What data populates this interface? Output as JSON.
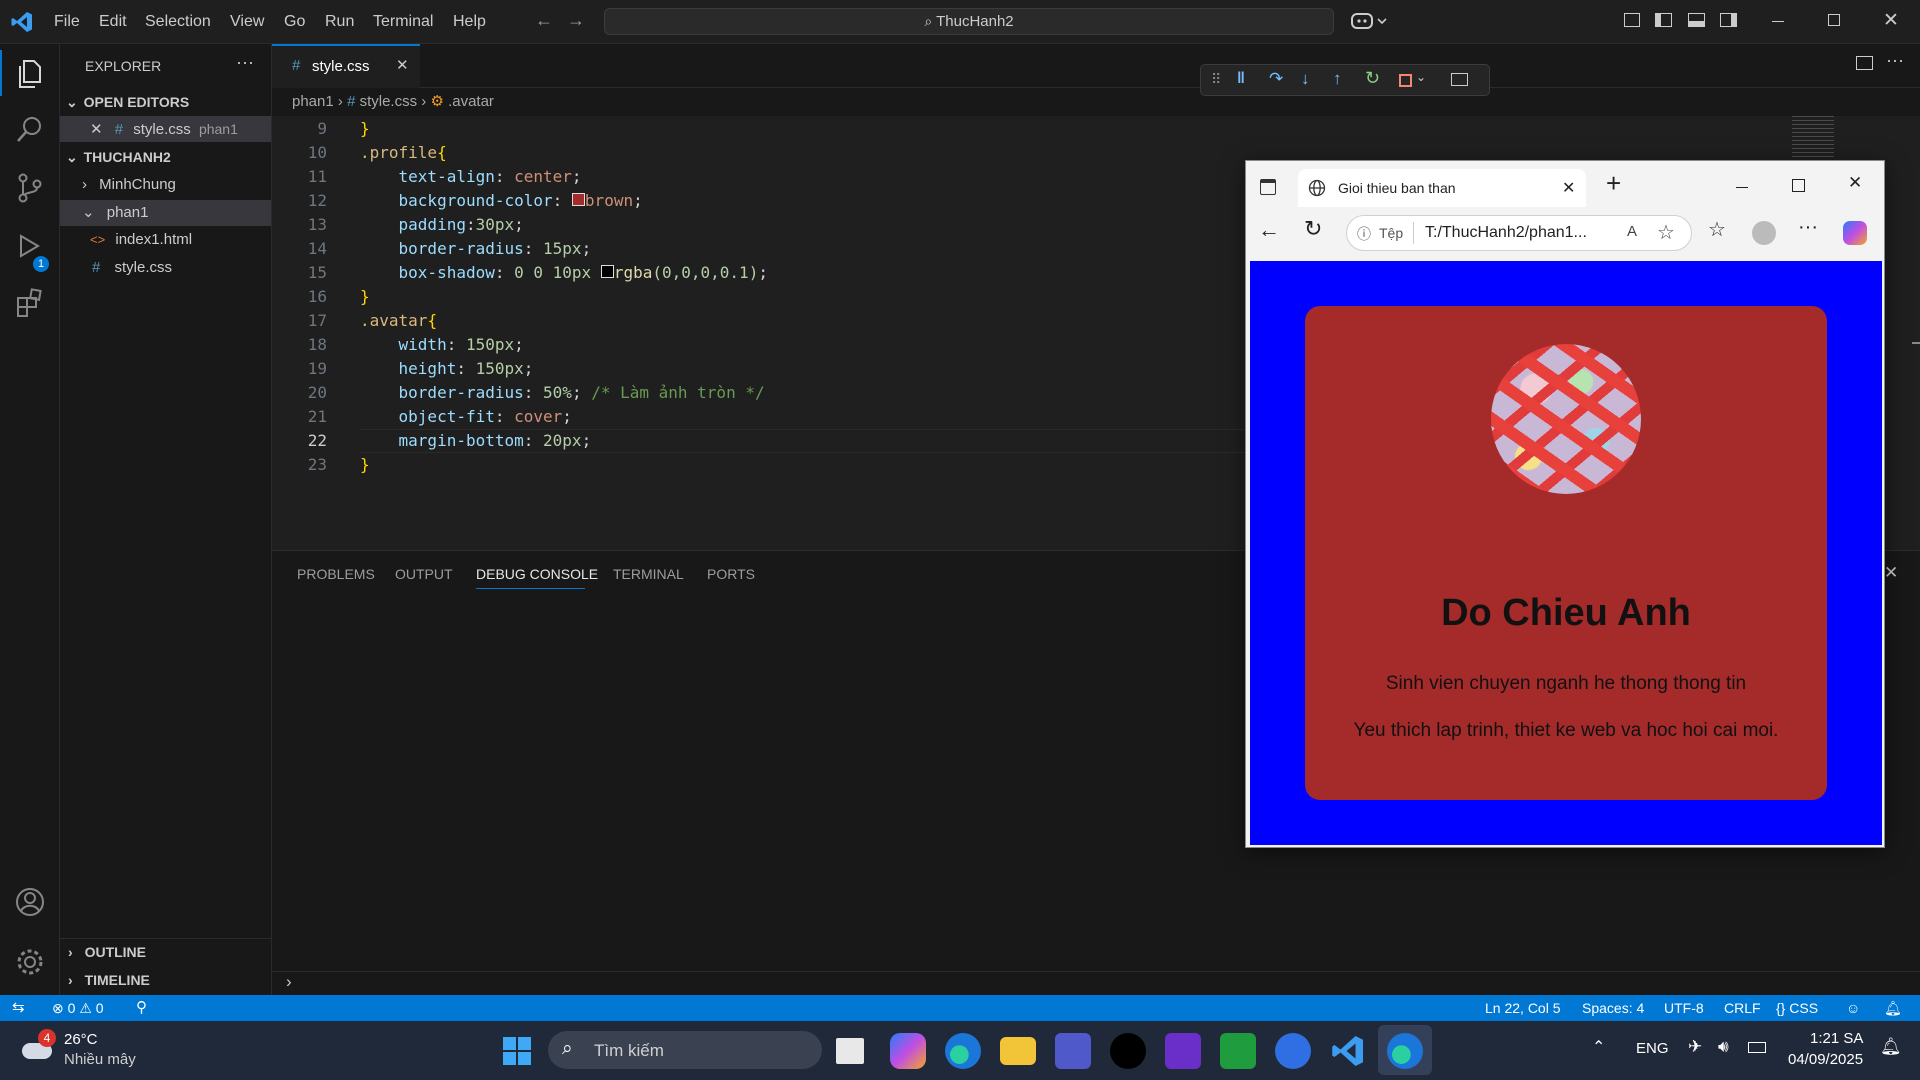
{
  "titlebar": {
    "menu": [
      "File",
      "Edit",
      "Selection",
      "View",
      "Go",
      "Run",
      "Terminal",
      "Help"
    ],
    "search_text": "ThucHanh2"
  },
  "sidebar": {
    "title": "EXPLORER",
    "open_editors_label": "OPEN EDITORS",
    "open_editor": {
      "name": "style.css",
      "folder": "phan1"
    },
    "project_label": "THUCHANH2",
    "tree": [
      {
        "label": "MinhChung",
        "type": "folder"
      },
      {
        "label": "phan1",
        "type": "folder-open"
      },
      {
        "label": "index1.html",
        "type": "html"
      },
      {
        "label": "style.css",
        "type": "css"
      }
    ],
    "outline_label": "OUTLINE",
    "timeline_label": "TIMELINE"
  },
  "activity": {
    "debug_badge": "1"
  },
  "editor": {
    "tab_label": "style.css",
    "breadcrumb": [
      "phan1",
      "style.css",
      ".avatar"
    ],
    "line_numbers": [
      "9",
      "10",
      "11",
      "12",
      "13",
      "14",
      "15",
      "16",
      "17",
      "18",
      "19",
      "20",
      "21",
      "22",
      "23"
    ]
  },
  "code": {
    "l9": "}",
    "l10_sel": ".profile",
    "l10_brace": "{",
    "l11_prop": "text-align",
    "l11_val": "center",
    "l12_prop": "background-color",
    "l12_val": "brown",
    "l13_prop": "padding",
    "l13_val": "30px",
    "l14_prop": "border-radius",
    "l14_val": "15px",
    "l15_prop": "box-shadow",
    "l15_val": "0 0 10px",
    "l15_fn": "rgba",
    "l15_args": "(0,0,0,0.1)",
    "l16": "}",
    "l17_sel": ".avatar",
    "l17_brace": "{",
    "l18_prop": "width",
    "l18_val": "150px",
    "l19_prop": "height",
    "l19_val": "150px",
    "l20_prop": "border-radius",
    "l20_val": "50%",
    "l20_cmt": "/* Làm ảnh tròn */",
    "l21_prop": "object-fit",
    "l21_val": "cover",
    "l22_prop": "margin-bottom",
    "l22_val": "20px",
    "l23": "}"
  },
  "panel": {
    "tabs": [
      "PROBLEMS",
      "OUTPUT",
      "DEBUG CONSOLE",
      "TERMINAL",
      "PORTS"
    ],
    "active": "DEBUG CONSOLE"
  },
  "statusbar": {
    "errors": "0",
    "warnings": "0",
    "position": "Ln 22, Col 5",
    "spaces": "Spaces: 4",
    "encoding": "UTF-8",
    "eol": "CRLF",
    "language": "CSS"
  },
  "browser": {
    "tab_title": "Gioi thieu ban than",
    "addr_label": "Tệp",
    "address": "T:/ThucHanh2/phan1...",
    "page": {
      "name": "Do Chieu Anh",
      "line1": "Sinh vien chuyen nganh he thong thong tin",
      "line2": "Yeu thich lap trinh, thiet ke web va hoc hoi cai moi."
    }
  },
  "taskbar": {
    "weather_temp": "26°C",
    "weather_desc": "Nhiều mây",
    "weather_badge": "4",
    "search_placeholder": "Tìm kiếm",
    "lang": "ENG",
    "time": "1:21 SA",
    "date": "04/09/2025"
  },
  "colors": {
    "accent": "#0078d4",
    "card": "#a52a2a",
    "page_bg": "#0000ff"
  }
}
